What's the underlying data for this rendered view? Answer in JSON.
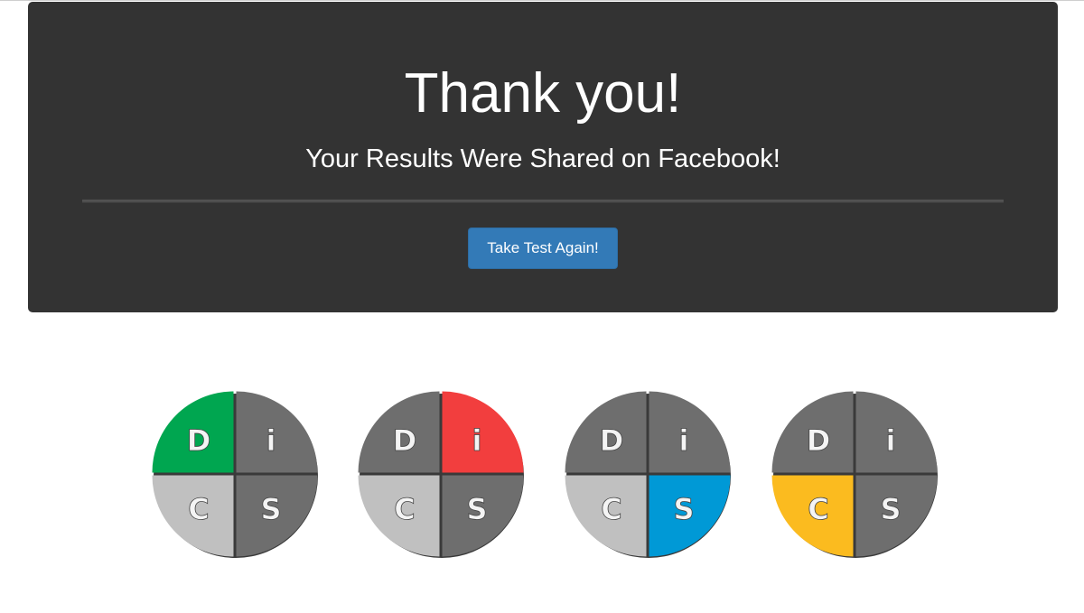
{
  "jumbotron": {
    "title": "Thank you!",
    "subtitle": "Your Results Were Shared on Facebook!",
    "button_label": "Take Test Again!"
  },
  "colors": {
    "panel": "#333333",
    "button": "#337ab7",
    "quad_dark": "#6e6e6e",
    "quad_light": "#c0c0c0",
    "d_green": "#00a650",
    "i_red": "#f23e3e",
    "s_blue": "#0099d6",
    "c_yellow": "#fbbb1f"
  },
  "disc_icons": [
    {
      "name": "disc-d-icon",
      "highlight": "D",
      "letters": [
        "D",
        "i",
        "C",
        "S"
      ]
    },
    {
      "name": "disc-i-icon",
      "highlight": "i",
      "letters": [
        "D",
        "i",
        "C",
        "S"
      ]
    },
    {
      "name": "disc-s-icon",
      "highlight": "S",
      "letters": [
        "D",
        "i",
        "C",
        "S"
      ]
    },
    {
      "name": "disc-c-icon",
      "highlight": "C",
      "letters": [
        "D",
        "i",
        "C",
        "S"
      ]
    }
  ]
}
